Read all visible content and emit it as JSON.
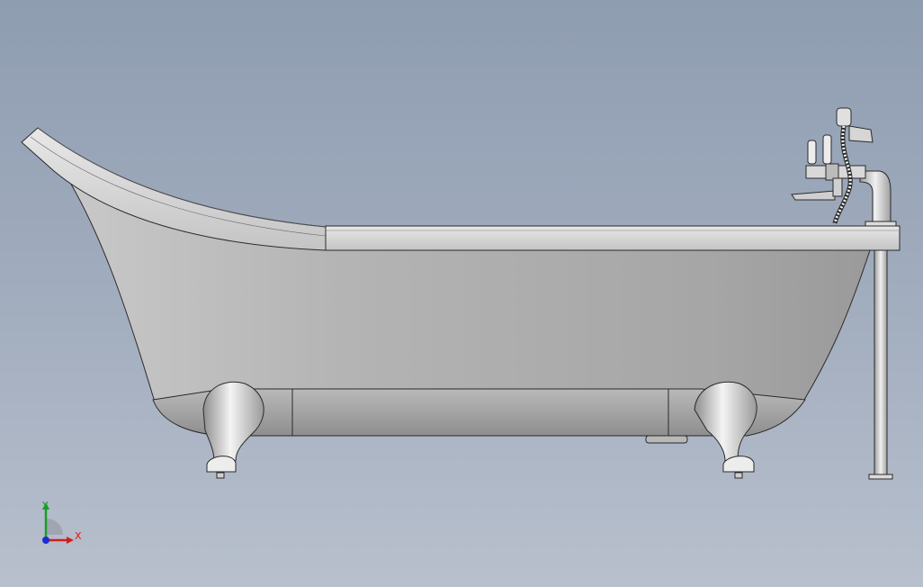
{
  "viewport": {
    "background_top": "#8f9db1",
    "background_bottom": "#b8c0cd"
  },
  "model": {
    "part": "clawfoot-slipper-bathtub",
    "body_color": "#a9a9a9",
    "rim_color": "#d4d4d4",
    "edge_color": "#2a2a2a",
    "feet_color": "#e6e6e6",
    "faucet_color": "#cfcfcf"
  },
  "triad": {
    "x_label": "X",
    "y_label": "Y",
    "x_color": "#d01c1c",
    "y_color": "#1c9c2a",
    "z_color": "#1c2cd0"
  }
}
